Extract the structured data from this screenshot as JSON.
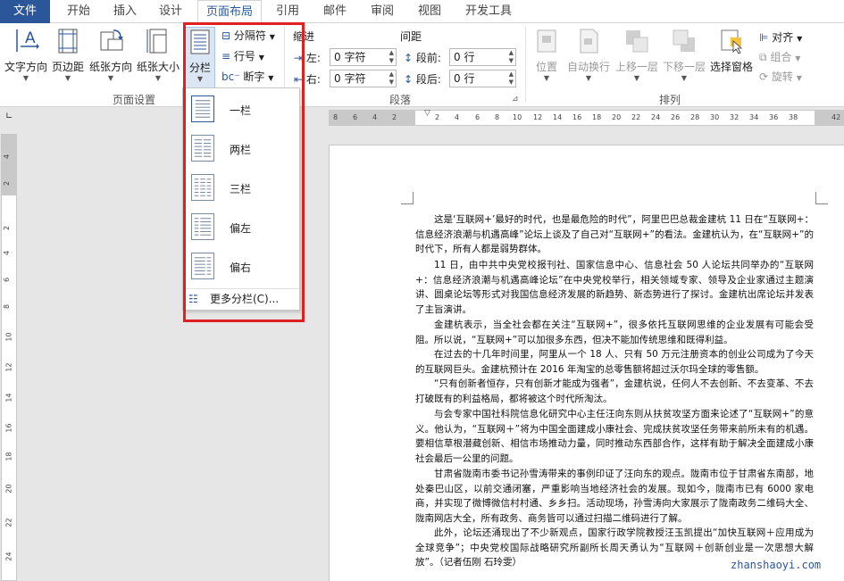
{
  "tabs": [
    "文件",
    "开始",
    "插入",
    "设计",
    "页面布局",
    "引用",
    "邮件",
    "审阅",
    "视图",
    "开发工具"
  ],
  "ribbon": {
    "page_setup": {
      "text_direction": "文字方向",
      "margins": "页边距",
      "orientation": "纸张方向",
      "size": "纸张大小",
      "columns": "分栏",
      "breaks": "分隔符",
      "line_numbers": "行号",
      "hyphenation": "断字",
      "group_label": "页面设置"
    },
    "paragraph": {
      "indent_title": "缩进",
      "spacing_title": "间距",
      "left_label": "左:",
      "right_label": "右:",
      "left_value": "0 字符",
      "right_value": "0 字符",
      "before_label": "段前:",
      "after_label": "段后:",
      "before_value": "0 行",
      "after_value": "0 行",
      "group_label": "段落"
    },
    "arrange": {
      "position": "位置",
      "wrap_text": "自动换行",
      "bring_forward": "上移一层",
      "send_backward": "下移一层",
      "selection_pane": "选择窗格",
      "align": "对齐",
      "group": "组合",
      "rotate": "旋转",
      "group_label": "排列"
    }
  },
  "columns_menu": {
    "items": [
      "一栏",
      "两栏",
      "三栏",
      "偏左",
      "偏右"
    ],
    "more": "更多分栏(C)..."
  },
  "ruler": {
    "h_ticks": [
      "8",
      "6",
      "4",
      "2",
      "2",
      "4",
      "6",
      "8",
      "10",
      "12",
      "14",
      "16",
      "18",
      "20",
      "22",
      "24",
      "26",
      "28",
      "30",
      "32",
      "34",
      "36",
      "38",
      "42"
    ],
    "v_ticks": [
      "4",
      "2",
      "2",
      "4",
      "6",
      "8",
      "10",
      "12",
      "14",
      "16",
      "18",
      "20",
      "22",
      "24"
    ]
  },
  "document": {
    "paragraphs": [
      "这是‘互联网+’最好的时代，也是最危险的时代”，阿里巴巴总裁金建杭 11 日在“互联网+：信息经济浪潮与机遇高峰”论坛上谈及了自己对“互联网+”的看法。金建杭认为，在“互联网+”的时代下，所有人都是弱势群体。",
      "11 日，由中共中央党校报刊社、国家信息中心、信息社会 50 人论坛共同举办的“互联网+：信息经济浪潮与机遇高峰论坛”在中央党校举行，相关领域专家、领导及企业家通过主题演讲、圆桌论坛等形式对我国信息经济发展的新趋势、新态势进行了探讨。金建杭出席论坛并发表了主旨演讲。",
      "金建杭表示，当全社会都在关注“互联网+”，很多依托互联网思维的企业发展有可能会受阻。所以说，“互联网+”可以加很多东西，但决不能加传统思维和既得利益。",
      "在过去的十几年时间里，阿里从一个 18 人、只有 50 万元注册资本的创业公司成为了今天的互联网巨头。金建杭预计在 2016 年淘宝的总零售额将超过沃尔玛全球的零售额。",
      "“只有创新者恒存，只有创新才能成为强者”，金建杭说，任何人不去创新、不去变革、不去打破既有的利益格局，都将被这个时代所淘汰。",
      "与会专家中国社科院信息化研究中心主任汪向东则从扶贫攻坚方面来论述了“互联网+”的意义。他认为，“互联网＋”将为中国全面建成小康社会、完成扶贫攻坚任务带来前所未有的机遇。要相信草根潜藏创新、相信市场推动力量，同时推动东西部合作，这样有助于解决全面建成小康社会最后一公里的问题。",
      "甘肃省陇南市委书记孙雪涛带来的事例印证了汪向东的观点。陇南市位于甘肃省东南部，地处秦巴山区，以前交通闭塞，严重影响当地经济社会的发展。现如今，陇南市已有 6000 家电商，并实现了微博微信村村通、乡乡扫。活动现场，孙雪涛向大家展示了陇南政务二维码大全、陇南网店大全，所有政务、商务皆可以通过扫描二维码进行了解。",
      "此外，论坛还涌现出了不少新观点，国家行政学院教授汪玉凯提出“加快互联网＋应用成为全球竞争”；中央党校国际战略研究所副所长周天勇认为“互联网＋创新创业是一次思想大解放”。（记者伍刚 石玲雯）"
    ]
  },
  "watermark": "zhanshaoyi.com",
  "colors": {
    "accent": "#2b579a",
    "highlight": "#e02020"
  }
}
